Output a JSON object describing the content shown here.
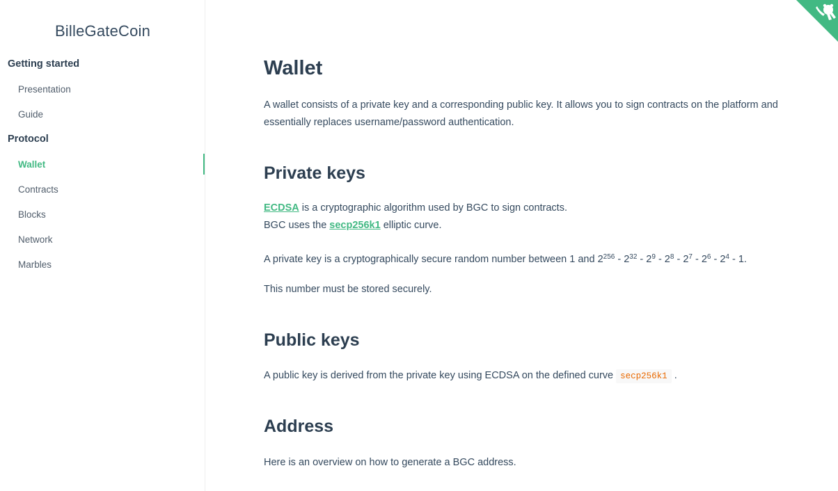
{
  "sidebar": {
    "app_name": "BilleGateCoin",
    "sections": [
      {
        "title": "Getting started",
        "items": [
          "Presentation",
          "Guide"
        ]
      },
      {
        "title": "Protocol",
        "items": [
          "Wallet",
          "Contracts",
          "Blocks",
          "Network",
          "Marbles"
        ]
      }
    ],
    "active_item": "Wallet"
  },
  "colors": {
    "accent": "#42b983",
    "text": "#34495e",
    "heading": "#2c3e50",
    "code": "#e96900"
  },
  "corner_icon": "github-octocat-icon",
  "content": {
    "title": "Wallet",
    "intro": "A wallet consists of a private key and a corresponding public key. It allows you to sign contracts on the platform and essentially replaces username/password authentication.",
    "private_keys": {
      "heading": "Private keys",
      "ecdsa_link": "ECDSA",
      "ecdsa_text": " is a cryptographic algorithm used by BGC to sign contracts.",
      "curve_prefix": "BGC uses the ",
      "curve_link": "secp256k1",
      "curve_suffix": " elliptic curve.",
      "range_text": "A private key is a cryptographically secure random number between 1 and ",
      "exponents": [
        "256",
        "32",
        "9",
        "8",
        "7",
        "6",
        "4"
      ],
      "range_end": " - 1.",
      "storage": "This number must be stored securely."
    },
    "public_keys": {
      "heading": "Public keys",
      "text": "A public key is derived from the private key using ECDSA on the defined curve ",
      "code": "secp256k1",
      "suffix": " ."
    },
    "address": {
      "heading": "Address",
      "text": "Here is an overview on how to generate a BGC address."
    }
  }
}
